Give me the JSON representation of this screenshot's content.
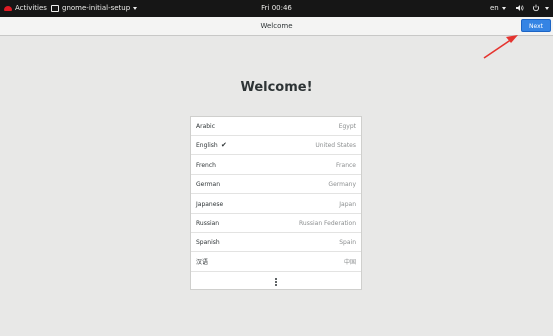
{
  "topbar": {
    "activities": "Activities",
    "app_menu": "gnome-initial-setup",
    "clock": "Fri 00:46",
    "language": "en",
    "icons": [
      "activities-logo-icon",
      "app-window-icon",
      "volume-icon",
      "power-icon",
      "caret-down-icon"
    ]
  },
  "header": {
    "title": "Welcome",
    "next_label": "Next"
  },
  "main": {
    "heading": "Welcome!",
    "languages": [
      {
        "name": "Arabic",
        "region": "Egypt",
        "selected": false
      },
      {
        "name": "English",
        "region": "United States",
        "selected": true
      },
      {
        "name": "French",
        "region": "France",
        "selected": false
      },
      {
        "name": "German",
        "region": "Germany",
        "selected": false
      },
      {
        "name": "Japanese",
        "region": "Japan",
        "selected": false
      },
      {
        "name": "Russian",
        "region": "Russian Federation",
        "selected": false
      },
      {
        "name": "Spanish",
        "region": "Spain",
        "selected": false
      },
      {
        "name": "汉语",
        "region": "中国",
        "selected": false
      }
    ],
    "check_mark": "✔"
  },
  "colors": {
    "accent": "#3584e4",
    "annotation_arrow": "#e5342f",
    "topbar_bg": "#161616"
  }
}
